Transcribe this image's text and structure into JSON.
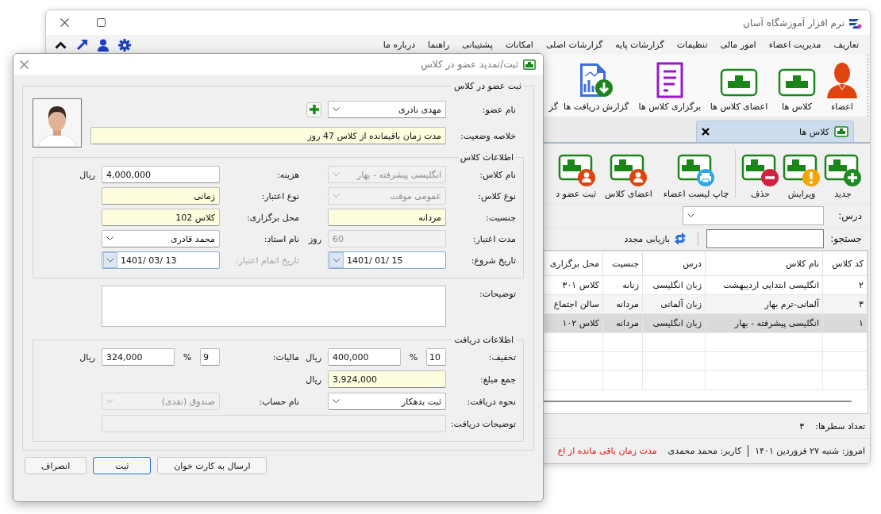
{
  "main_window": {
    "title": "نرم افزار آموزشگاه آسان",
    "menu": [
      "تعاریف",
      "مدیریت اعضاء",
      "امور مالی",
      "تنظیمات",
      "گزارشات پایه",
      "گزارشات اصلی",
      "امکانات",
      "پشتیبانی",
      "راهنما",
      "درباره ما"
    ],
    "toolbar": [
      {
        "label": "اعضاء",
        "kind": "person"
      },
      {
        "label": "کلاس ها",
        "kind": "stamp"
      },
      {
        "label": "اعضای کلاس ها",
        "kind": "stamp"
      },
      {
        "label": "برگزاری کلاس ها",
        "kind": "list"
      },
      {
        "label": "گزارش دریافت ها",
        "kind": "report"
      },
      {
        "label": "گز",
        "kind": "covered"
      }
    ],
    "tabs": [
      {
        "label": "کلاس ها",
        "selected": true
      }
    ],
    "actions": [
      {
        "label": "جدید",
        "kind": "add"
      },
      {
        "label": "ویرایش",
        "kind": "edit"
      },
      {
        "label": "حذف",
        "kind": "delete"
      },
      {
        "kind": "separator"
      },
      {
        "label": "چاپ لیست اعضاء",
        "kind": "print"
      },
      {
        "label": "اعضای کلاس",
        "kind": "members"
      },
      {
        "label": "ثبت عضو د",
        "kind": "register"
      }
    ],
    "course_filter": {
      "label": "درس:"
    },
    "search": {
      "label": "جستجو:"
    },
    "refresh": "بازیابی مجدد",
    "table": {
      "columns": [
        "کد کلاس",
        "نام کلاس",
        "درس",
        "جنسیت",
        "محل برگزاری"
      ],
      "rows": [
        {
          "cells": [
            "۲",
            "انگلیسی ابتدایی اردیبهشت",
            "زبان انگلیسی",
            "زنانه",
            "کلاس ۳۰۱"
          ],
          "selected": false
        },
        {
          "cells": [
            "۳",
            "آلمانی-ترم بهار",
            "زبان آلمانی",
            "مردانه",
            "سالن اجتماع"
          ],
          "selected": false
        },
        {
          "cells": [
            "۱",
            "انگلیسی پیشرفته - بهار",
            "زبان انگلیسی",
            "مردانه",
            "کلاس ۱۰۲"
          ],
          "selected": true
        }
      ]
    },
    "row_count": {
      "label": "تعداد سطرها:",
      "value": "۳"
    },
    "status_bar": {
      "date": "امروز: شنبه ۲۷ فروردین ۱۴۰۱",
      "user": "کاربر: محمد محمدی",
      "warning": "مدت زمان باقی مانده از اع"
    }
  },
  "dialog": {
    "title": "ثبت/تمدید عضو در کلاس",
    "member_section": {
      "title": "ثبت عضو در کلاس",
      "member": {
        "label": "نام عضو:",
        "value": "مهدی نادری"
      },
      "status": {
        "label": "خلاصه وضعیت:",
        "value": "مدت زمان باقیمانده از کلاس 47 روز"
      }
    },
    "class_section": {
      "title": "اطلاعات کلاس",
      "rows": [
        [
          {
            "label": "نام کلاس:",
            "value": "انگلیسی پیشرفته - بهار",
            "kind": "dropdown",
            "disabled": true,
            "readonly": false,
            "label_disabled": false
          },
          {
            "label": "هزینه:",
            "value": "4,000,000",
            "unit": "ریال",
            "kind": "text",
            "disabled": false,
            "readonly": false,
            "label_disabled": false
          }
        ],
        [
          {
            "label": "نوع کلاس:",
            "value": "عمومی موقت",
            "kind": "dropdown",
            "disabled": true,
            "readonly": false,
            "label_disabled": false
          },
          {
            "label": "نوع اعتبار:",
            "value": "زمانی",
            "kind": "text",
            "disabled": false,
            "readonly": true,
            "label_disabled": false
          }
        ],
        [
          {
            "label": "جنسیت:",
            "value": "مردانه",
            "kind": "text",
            "disabled": false,
            "readonly": true,
            "label_disabled": false
          },
          {
            "label": "محل برگزاری:",
            "value": "کلاس 102",
            "kind": "text",
            "disabled": false,
            "readonly": true,
            "label_disabled": false
          }
        ],
        [
          {
            "label": "مدت اعتبار:",
            "value": "60",
            "unit": "روز",
            "kind": "text",
            "disabled": true,
            "readonly": false,
            "label_disabled": false
          },
          {
            "label": "نام استاد:",
            "value": "محمد قادری",
            "kind": "dropdown",
            "disabled": false,
            "readonly": false,
            "label_disabled": false
          }
        ],
        [
          {
            "label": "تاریخ شروع:",
            "value": "1401/ 01/ 15",
            "kind": "date",
            "disabled": false,
            "readonly": false,
            "label_disabled": false
          },
          {
            "label": "تاریخ اتمام اعتبار:",
            "value": "1401/ 03/ 13",
            "kind": "date",
            "disabled": false,
            "readonly": false,
            "label_disabled": true
          }
        ]
      ]
    },
    "notes": {
      "label": "توضیحات:"
    },
    "payment_section": {
      "title": "اطلاعات دریافت",
      "rows": [
        [
          {
            "label": "تخفیف:",
            "percent": "10",
            "percent_unit": "%",
            "value": "400,000",
            "unit": "ریال",
            "kind": "percent_amount",
            "disabled": false,
            "readonly": false,
            "label_disabled": false
          },
          {
            "label": "مالیات:",
            "percent": "9",
            "percent_unit": "%",
            "value": "324,000",
            "unit": "ریال",
            "kind": "percent_amount",
            "disabled": false,
            "readonly": false,
            "label_disabled": false
          }
        ],
        [
          {
            "label": "جمع مبلغ:",
            "value": "3,924,000",
            "unit": "ریال",
            "kind": "text",
            "disabled": false,
            "readonly": true,
            "label_disabled": false
          }
        ],
        [
          {
            "label": "نحوه دریافت:",
            "value": "ثبت بدهکار",
            "kind": "dropdown",
            "disabled": false,
            "readonly": false,
            "label_disabled": false
          },
          {
            "label": "نام حساب:",
            "value": "صندوق (نقدی)",
            "kind": "dropdown",
            "disabled": true,
            "readonly": false,
            "label_disabled": false
          }
        ],
        [
          {
            "label": "توضیحات دریافت:",
            "kind": "wide_text",
            "disabled": true,
            "readonly": false,
            "label_disabled": false
          }
        ]
      ]
    },
    "buttons": [
      {
        "label": "ارسال به کارت خوان",
        "default": false
      },
      {
        "label": "ثبت",
        "default": true
      },
      {
        "label": "انصراف",
        "default": false
      }
    ]
  }
}
